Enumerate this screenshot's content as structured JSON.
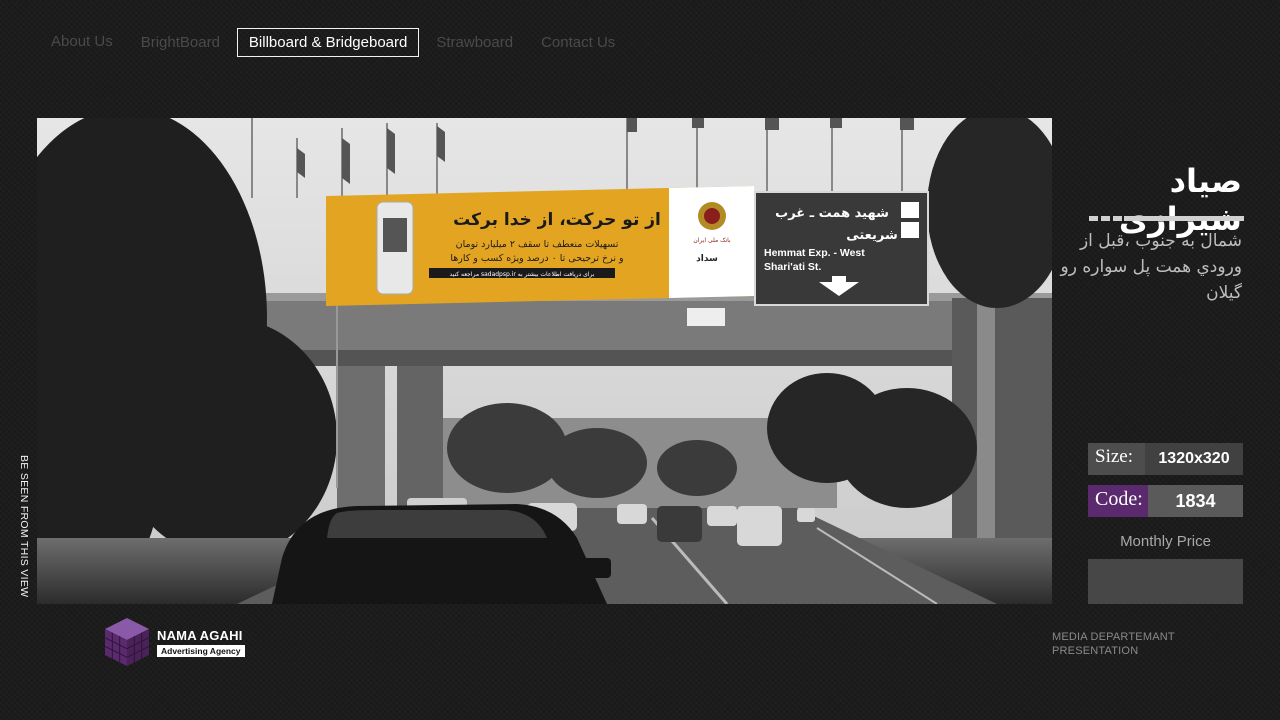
{
  "nav": {
    "items": [
      {
        "label": "About Us",
        "active": false
      },
      {
        "label": "BrightBoard",
        "active": false
      },
      {
        "label": "Billboard & Bridgeboard",
        "active": true
      },
      {
        "label": "Strawboard",
        "active": false
      },
      {
        "label": "Contact Us",
        "active": false
      }
    ]
  },
  "photo": {
    "billboard": {
      "headline": "از تو حرکت، از خدا برکت",
      "line1": "تسهیلات منعطف تا سقف ۲ میلیارد تومان",
      "line2": "و نرخ ترجیحی تا ۰ درصد ویژه کسب و کارها",
      "strip": "برای دریافت اطلاعات بیشتر به sadadpsp.ir مراجعه کنید",
      "brand": "سداد",
      "bank": "بانک ملی ایران"
    },
    "street_sign": {
      "fa_line1": "شهید همت ـ غرب",
      "fa_line2": "شریعتی",
      "en_line1": "Hemmat Exp. - West",
      "en_line2": "Shari'ati St."
    }
  },
  "vertical_caption": "BE SEEN FROM THIS VIEW",
  "location": {
    "title": "صیاد شیرازی",
    "description": "شمال به جنوب ،قبل از ورودي همت پل سواره رو گیلان"
  },
  "specs": {
    "size_label": "Size:",
    "size_value": "1320x320",
    "code_label": "Code:",
    "code_value": "1834",
    "price_label": "Monthly Price",
    "price_value": ""
  },
  "footer": {
    "logo_name": "NAMA AGAHI",
    "logo_sub": "Advertising Agency",
    "right_line1": "MEDIA DEPARTEMANT",
    "right_line2": "PRESENTATION"
  },
  "colors": {
    "accent_purple": "#5b2a6e",
    "billboard_yellow": "#e3a521",
    "sign_gray": "#3a3a3a"
  }
}
